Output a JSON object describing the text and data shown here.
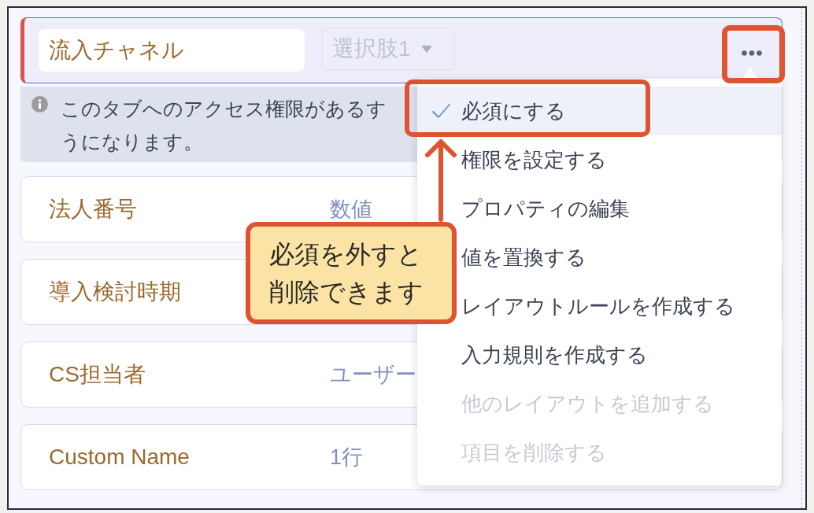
{
  "fields": [
    {
      "name": "流入チャネル",
      "type": "選択肢1",
      "selected": true,
      "required": true,
      "notice": [
        "このタブへのアクセス権限があるす",
        "うになります。"
      ]
    },
    {
      "name": "法人番号",
      "type": "数値",
      "selected": false,
      "required": false
    },
    {
      "name": "導入検討時期",
      "selected": false,
      "required": false
    },
    {
      "name": "CS担当者",
      "type": "ユーザー",
      "selected": false,
      "required": false
    },
    {
      "name": "Custom Name",
      "type": "1行",
      "selected": false,
      "required": false
    }
  ],
  "menu": {
    "items": [
      {
        "label": "必須にする",
        "checked": true,
        "disabled": false
      },
      {
        "label": "権限を設定する",
        "checked": false,
        "disabled": false
      },
      {
        "label": "プロパティの編集",
        "checked": false,
        "disabled": false
      },
      {
        "label": "値を置換する",
        "checked": false,
        "disabled": false
      },
      {
        "label": "レイアウトルールを作成する",
        "checked": false,
        "disabled": false
      },
      {
        "label": "入力規則を作成する",
        "checked": false,
        "disabled": false
      },
      {
        "label": "他のレイアウトを追加する",
        "checked": false,
        "disabled": true
      },
      {
        "label": "項目を削除する",
        "checked": false,
        "disabled": true
      }
    ]
  },
  "callout": {
    "text": "必須を外すと削除できます"
  }
}
